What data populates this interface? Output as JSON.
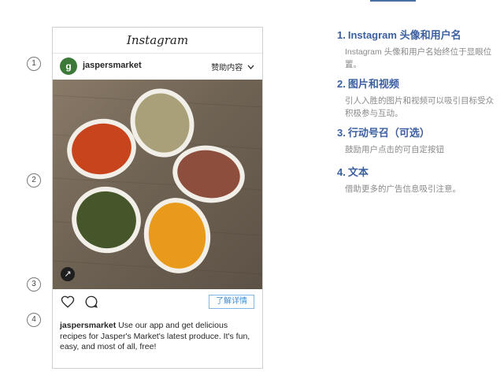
{
  "card": {
    "app_title": "Instagram",
    "avatar_letter": "g",
    "username": "jaspersmarket",
    "sponsored_label": "赞助内容",
    "link_glyph": "↗",
    "learn_more_label": "了解详情",
    "caption_user": "jaspersmarket",
    "caption_text": "Use our app and get delicious recipes for Jasper's Market's latest produce. It's fun, easy, and most of all, free!"
  },
  "markers": [
    "1",
    "2",
    "3",
    "4"
  ],
  "annotations": [
    {
      "num": "1.",
      "title": "Instagram 头像和用户名",
      "desc": "Instagram 头像和用户名始终位于显眼位置。"
    },
    {
      "num": "2.",
      "title": "图片和视频",
      "desc": "引人入胜的图片和视频可以吸引目标受众积极参与互动。"
    },
    {
      "num": "3.",
      "title": "行动号召（可选）",
      "desc": "鼓励用户点击的可自定按钮"
    },
    {
      "num": "4.",
      "title": "文本",
      "desc": "借助更多的广告信息吸引注意。"
    }
  ],
  "colors": {
    "accent": "#3b5fa0",
    "button_border": "#7fb6e6",
    "button_text": "#3f8fd6"
  }
}
